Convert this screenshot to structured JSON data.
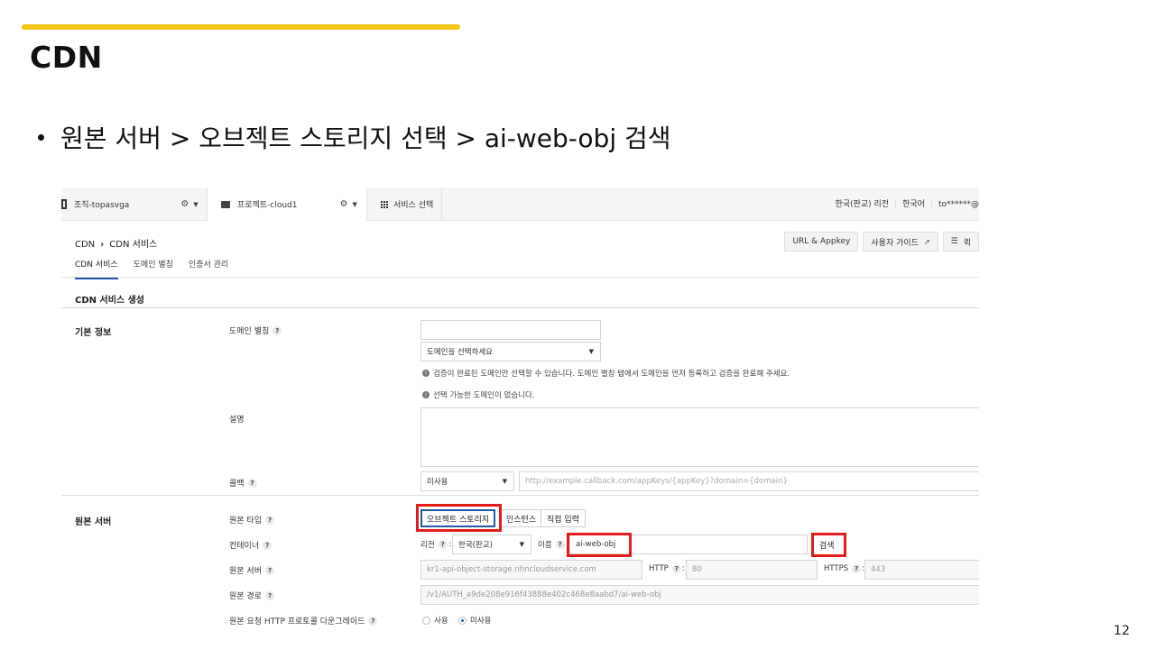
{
  "slide": {
    "title": "CDN",
    "bullet": "원본 서버 > 오브젝트 스토리지 선택 > ai-web-obj 검색",
    "page_number": "12"
  },
  "topbar": {
    "org": "조직-topasvga",
    "project": "프로젝트-cloud1",
    "service_select": "서비스 선택",
    "region": "한국(판교) 리전",
    "language": "한국어",
    "user": "to******@"
  },
  "breadcrumb": {
    "root": "CDN",
    "current": "CDN 서비스"
  },
  "top_buttons": {
    "url_appkey": "URL & Appkey",
    "user_guide": "사용자 가이드",
    "menu": "퀵"
  },
  "tabs": [
    "CDN 서비스",
    "도메인 별칭",
    "인증서 관리"
  ],
  "section_title": "CDN 서비스 생성",
  "basic_info": {
    "group_label": "기본 정보",
    "domain_alias_label": "도메인 별칭",
    "domain_alias_value": "",
    "domain_select_value": "도메인을 선택하세요",
    "note_1": "검증이 완료된 도메인만 선택할 수 있습니다. 도메인 별칭 탭에서 도메인을 먼저 등록하고 검증을 완료해 주세요.",
    "note_2": "선택 가능한 도메인이 없습니다.",
    "description_label": "설명",
    "callback_label": "콜백",
    "callback_select": "미사용",
    "callback_placeholder": "http://example.callback.com/appKeys/{appKey}?domain={domain}"
  },
  "origin": {
    "group_label": "원본 서버",
    "origin_type_label": "원본 타입",
    "type_object_storage": "오브젝트 스토리지",
    "type_instance": "인스턴스",
    "type_direct": "직접 입력",
    "container_label": "컨테이너",
    "region_label": "리전",
    "region_value": "한국(판교)",
    "name_label": "이름",
    "name_value": "ai-web-obj",
    "search_button": "검색",
    "origin_server_label": "원본 서버",
    "origin_server_value": "kr1-api-object-storage.nhncloudservice.com",
    "http_label": "HTTP",
    "http_value": "80",
    "https_label": "HTTPS",
    "https_value": "443",
    "origin_path_label": "원본 경로",
    "origin_path_value": "/v1/AUTH_a9de208e916f43888e402c468e8aabd7/ai-web-obj",
    "downgrade_label": "원본 요청 HTTP 프로토콜 다운그레이드",
    "radio_use": "사용",
    "radio_unused": "미사용"
  },
  "colors": {
    "accent": "#f5c518",
    "highlight": "#e31b1b",
    "primary": "#1e5aa8"
  }
}
